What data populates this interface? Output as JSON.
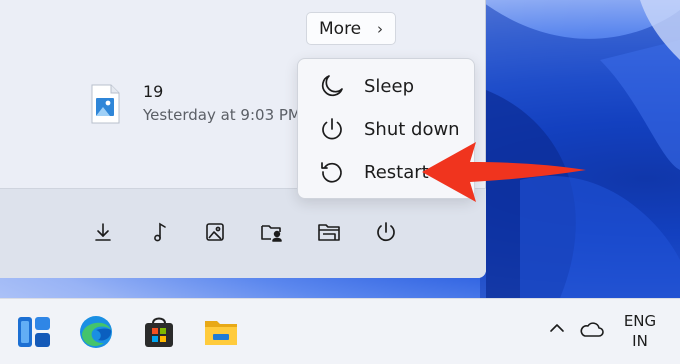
{
  "start_menu": {
    "more_label": "More",
    "more_chevron": "›",
    "recent_file": {
      "name": "19",
      "time": "Yesterday at 9:03 PM",
      "icon": "image-file-icon"
    },
    "footer_icons": [
      "downloads-icon",
      "music-icon",
      "pictures-icon",
      "user-folder-icon",
      "file-explorer-icon",
      "power-icon"
    ]
  },
  "power_menu": {
    "items": [
      {
        "label": "Sleep",
        "icon": "moon-icon"
      },
      {
        "label": "Shut down",
        "icon": "power-icon"
      },
      {
        "label": "Restart",
        "icon": "restart-icon"
      }
    ]
  },
  "annotation": {
    "arrow_color": "#f0341e"
  },
  "taskbar": {
    "apps": [
      "widgets-icon",
      "edge-icon",
      "store-icon",
      "file-explorer-icon"
    ],
    "tray": {
      "lang_line1": "ENG",
      "lang_line2": "IN"
    }
  }
}
